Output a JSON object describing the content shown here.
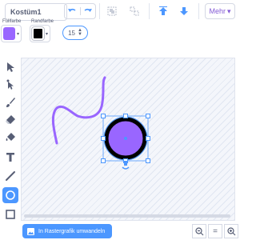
{
  "costume": {
    "name": "Kostüm1"
  },
  "fill": {
    "label": "Füllfarbe",
    "color": "#9966ff"
  },
  "outline": {
    "label": "Randfarbe",
    "color": "#000000"
  },
  "stroke_width": "15",
  "more_label": "Mehr",
  "toolbar_icons": [
    "undo-icon",
    "redo-icon",
    "group-icon",
    "ungroup-icon",
    "forward-icon",
    "backward-icon"
  ],
  "tools": [
    "select",
    "reshape",
    "brush",
    "eraser",
    "fill",
    "text",
    "line",
    "circle",
    "rectangle"
  ],
  "active_tool": "circle",
  "convert_button": "In Rastergrafik umwandeln",
  "zoom": {
    "out": "−",
    "reset": "=",
    "in": "+"
  },
  "colors": {
    "accent": "#4c97ff",
    "purple": "#9966ff",
    "selection": "#855cd6"
  }
}
